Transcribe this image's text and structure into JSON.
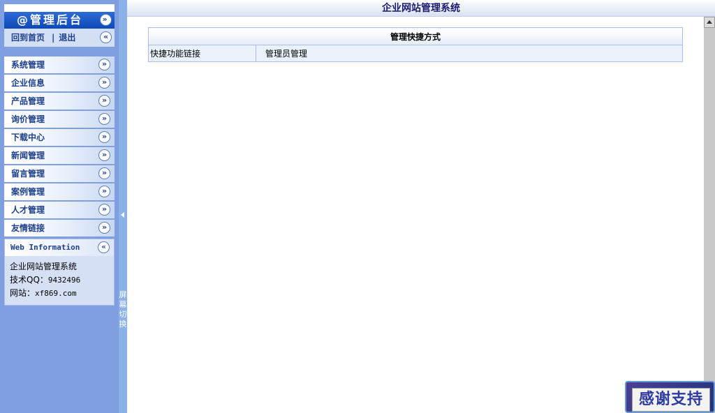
{
  "topbar": {
    "title": "企业网站管理系统"
  },
  "sidebar": {
    "header": "@管理后台",
    "header_icon": "chevron-double-down-icon",
    "links": {
      "home": "回到首页",
      "separator": "|",
      "logout": "退出"
    },
    "collapse_icon": "chevron-double-left-icon",
    "items": [
      {
        "label": "系统管理"
      },
      {
        "label": "企业信息"
      },
      {
        "label": "产品管理"
      },
      {
        "label": "询价管理"
      },
      {
        "label": "下载中心"
      },
      {
        "label": "新闻管理"
      },
      {
        "label": "留言管理"
      },
      {
        "label": "案例管理"
      },
      {
        "label": "人才管理"
      },
      {
        "label": "友情链接"
      }
    ],
    "webinfo": {
      "title": "Web Information",
      "name": "企业网站管理系统",
      "qq_label": "技术QQ：",
      "qq": "9432496",
      "site_label": "网站：",
      "site": "xf869.com"
    }
  },
  "splitter": {
    "label": "屏幕切换"
  },
  "shortcuts": {
    "title": "管理快捷方式",
    "row_label": "快捷功能链接",
    "link": "管理员管理"
  },
  "badge": {
    "text": "感谢支持"
  },
  "colors": {
    "sidebar_bg": "#7f9fe0",
    "header_blue": "#0d48b8",
    "menu_text": "#1d3f8c",
    "title_text": "#1b1b6e"
  }
}
